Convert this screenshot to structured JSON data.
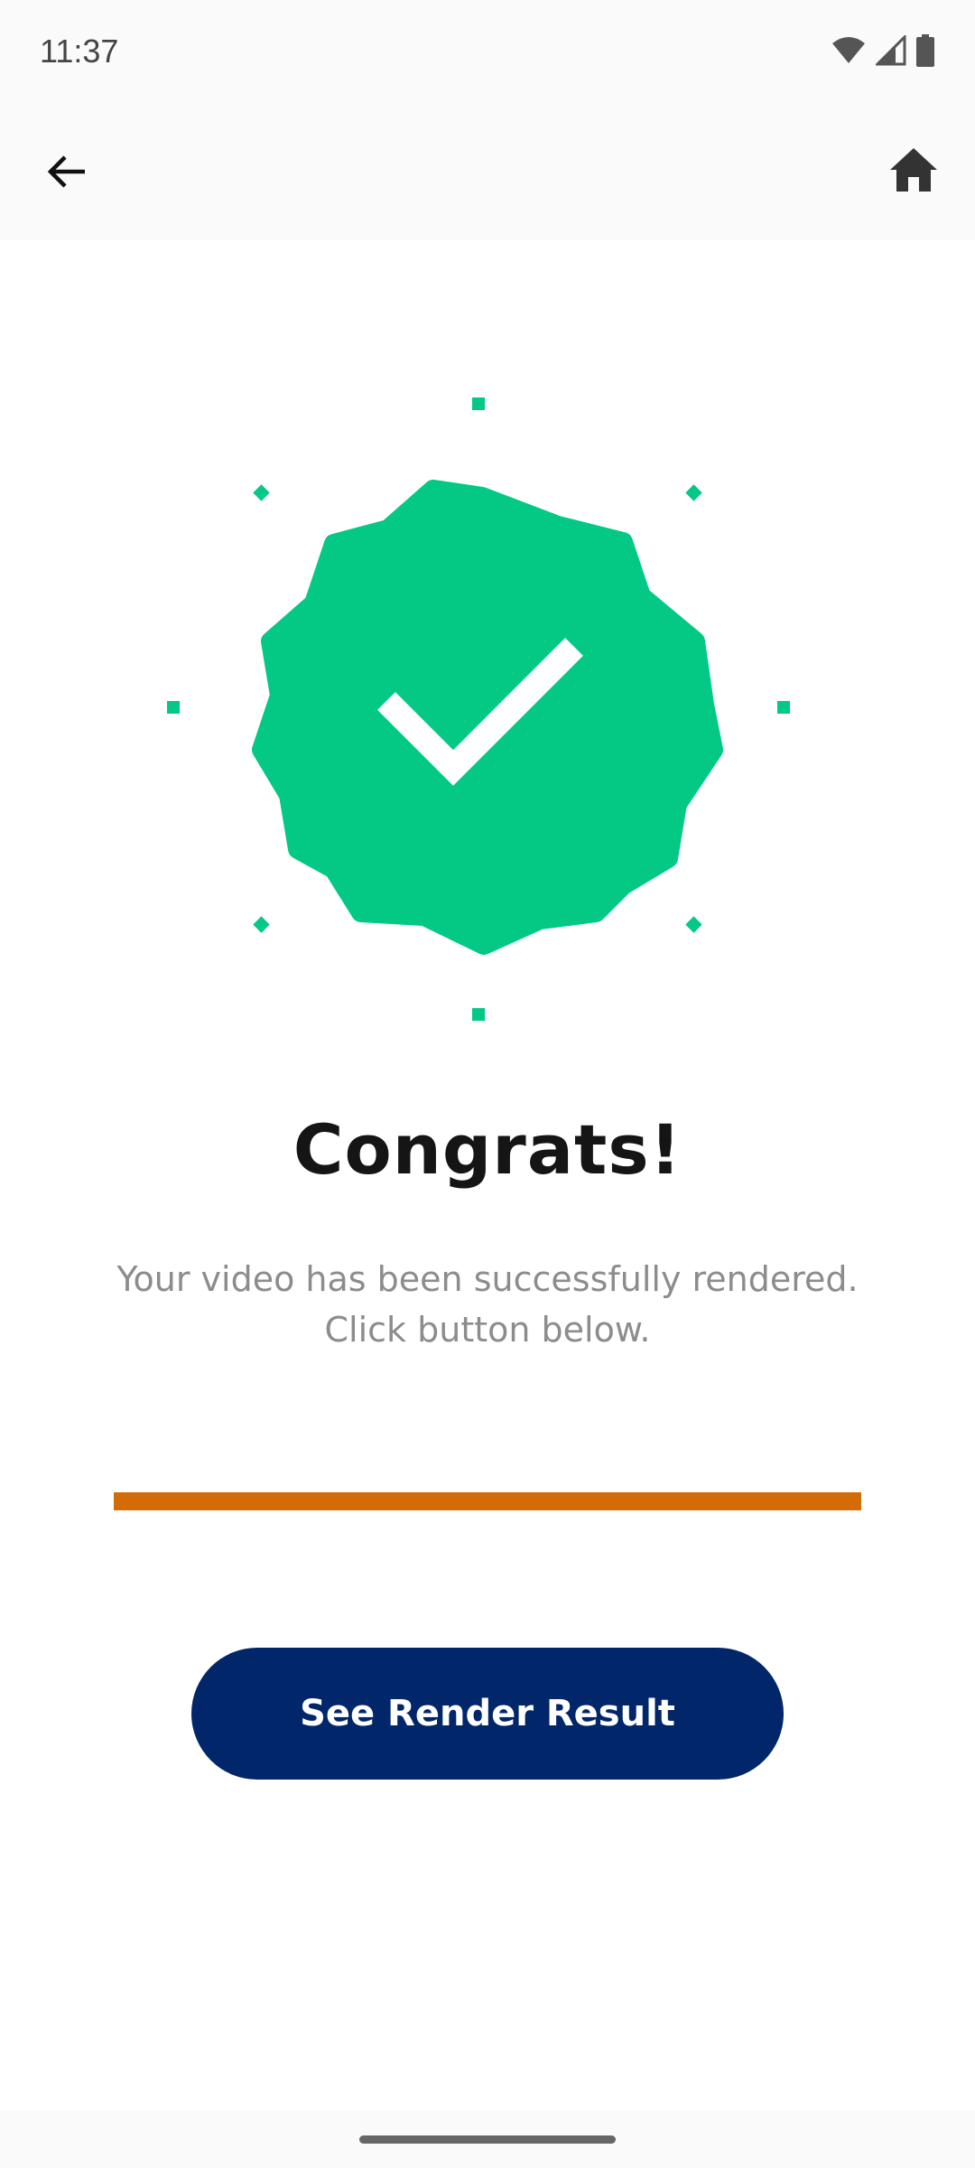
{
  "status_bar": {
    "time": "11:37",
    "icons": [
      "wifi-icon",
      "cell-signal-icon",
      "battery-icon"
    ]
  },
  "app_bar": {
    "back_icon": "arrow-back-icon",
    "home_icon": "home-icon"
  },
  "success": {
    "badge_icon": "verified-check-badge-icon",
    "accent_color": "#03C985",
    "title": "Congrats!",
    "subtitle_line1": "Your video has been successfully rendered.",
    "subtitle_line2": "Click button below."
  },
  "progress": {
    "value_percent": 100,
    "color": "#D36B06"
  },
  "cta": {
    "label": "See Render Result",
    "color": "#012669"
  }
}
